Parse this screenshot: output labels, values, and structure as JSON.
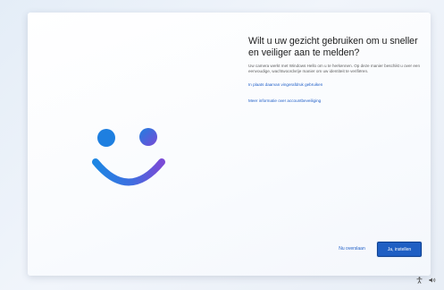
{
  "dialog": {
    "title": "Wilt u uw gezicht gebruiken om u sneller en veiliger aan te melden?",
    "description": "Uw camera werkt met Windows Hello om u te herkennen. Op deze manier beschikt u over een eenvoudige, wachtwoordvrije manier om uw identiteit te verifiëren.",
    "alt_link": "In plaats daarvan vingerafdruk gebruiken",
    "info_link": "Meer informatie over accountbeveiliging",
    "skip_label": "Nu overslaan",
    "primary_label": "Ja, instellen",
    "illustration": "smiley-face-icon"
  },
  "system_tray": {
    "icons": [
      "accessibility-icon",
      "volume-icon"
    ]
  },
  "colors": {
    "accent": "#1f5fc3",
    "face_gradient_start": "#1e7fe0",
    "face_gradient_end": "#7a4ad6"
  }
}
